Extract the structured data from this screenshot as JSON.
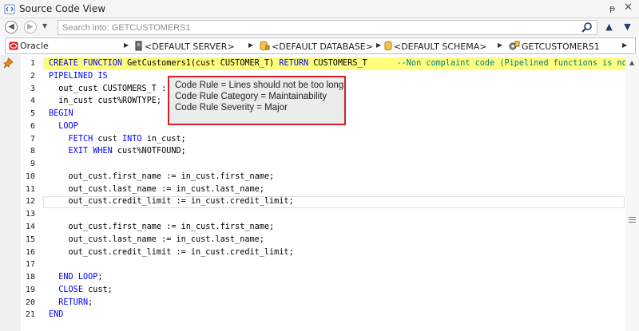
{
  "window": {
    "title": "Source Code View",
    "pin_glyph": "ᵽ",
    "close_glyph": "✕"
  },
  "search": {
    "placeholder": "Search into: GETCUSTOMERS1",
    "value": "",
    "search_icon": "search-icon",
    "up_glyph": "▲",
    "down_glyph": "▼"
  },
  "breadcrumb": {
    "items": [
      {
        "label": "Oracle",
        "icon": "oracle-icon"
      },
      {
        "label": "<DEFAULT SERVER>",
        "icon": "server-icon"
      },
      {
        "label": "<DEFAULT DATABASE>",
        "icon": "database-icon"
      },
      {
        "label": "<DEFAULT SCHEMA>",
        "icon": "schema-icon"
      },
      {
        "label": "GETCUSTOMERS1",
        "icon": "function-icon"
      }
    ],
    "separator_glyph": "▶"
  },
  "editor": {
    "highlighted_line": 1,
    "current_line": 12,
    "lines": [
      {
        "n": "1",
        "code": "CREATE FUNCTION GetCustomers1(cust CUSTOMER_T) RETURN CUSTOMERS_T      --Non complaint code (Pipelined functions is no"
      },
      {
        "n": "2",
        "code": "PIPELINED IS"
      },
      {
        "n": "3",
        "code": "  out_cust CUSTOMERS_T :"
      },
      {
        "n": "4",
        "code": "  in_cust cust%ROWTYPE;"
      },
      {
        "n": "5",
        "code": "BEGIN"
      },
      {
        "n": "6",
        "code": "  LOOP"
      },
      {
        "n": "7",
        "code": "    FETCH cust INTO in_cust;"
      },
      {
        "n": "8",
        "code": "    EXIT WHEN cust%NOTFOUND;"
      },
      {
        "n": "9",
        "code": ""
      },
      {
        "n": "10",
        "code": "    out_cust.first_name := in_cust.first_name;"
      },
      {
        "n": "11",
        "code": "    out_cust.last_name := in_cust.last_name;"
      },
      {
        "n": "12",
        "code": "    out_cust.credit_limit := in_cust.credit_limit;"
      },
      {
        "n": "13",
        "code": ""
      },
      {
        "n": "14",
        "code": "    out_cust.first_name := in_cust.first_name;"
      },
      {
        "n": "15",
        "code": "    out_cust.last_name := in_cust.last_name;"
      },
      {
        "n": "16",
        "code": "    out_cust.credit_limit := in_cust.credit_limit;"
      },
      {
        "n": "17",
        "code": ""
      },
      {
        "n": "18",
        "code": "  END LOOP;"
      },
      {
        "n": "19",
        "code": "  CLOSE cust;"
      },
      {
        "n": "20",
        "code": "  RETURN;"
      },
      {
        "n": "21",
        "code": "END"
      }
    ],
    "keywords": [
      "CREATE",
      "FUNCTION",
      "RETURN",
      "PIPELINED",
      "IS",
      "BEGIN",
      "LOOP",
      "FETCH",
      "INTO",
      "EXIT",
      "WHEN",
      "END",
      "CLOSE"
    ]
  },
  "tooltip": {
    "rule": "Code Rule = Lines should not be too long",
    "category": "Code Rule Category = Maintainability",
    "severity": "Code Rule Severity = Major"
  },
  "colors": {
    "keyword": "#0000ff",
    "comment": "#008080",
    "line_highlight": "#fdfd7e",
    "tooltip_border": "#d4202a",
    "oracle_red": "#e0191c"
  }
}
